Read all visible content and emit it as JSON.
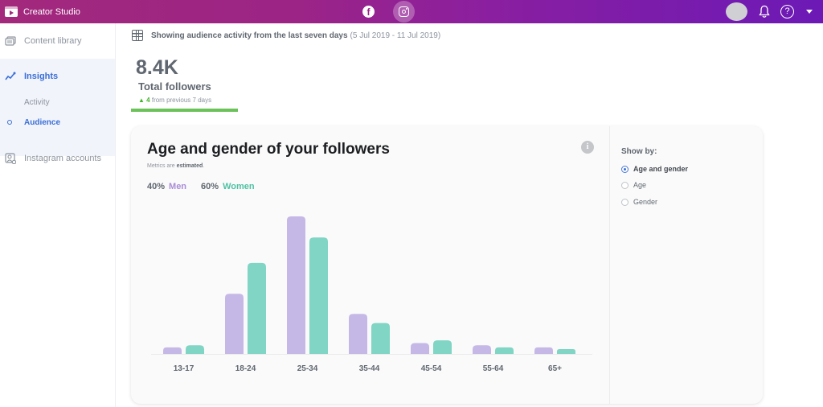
{
  "app": {
    "title": "Creator Studio",
    "platforms": [
      {
        "name": "Facebook",
        "icon": "facebook-icon",
        "active": false
      },
      {
        "name": "Instagram",
        "icon": "instagram-icon",
        "active": true
      }
    ],
    "header_icons": [
      "avatar",
      "bell-icon",
      "help-icon",
      "caret-down-icon"
    ]
  },
  "sidebar": {
    "items": [
      {
        "label": "Content library",
        "icon": "content-library-icon"
      },
      {
        "label": "Insights",
        "icon": "insights-icon",
        "active": true
      },
      {
        "label": "Activity"
      },
      {
        "label": "Audience",
        "active": true
      },
      {
        "label": "Instagram accounts",
        "icon": "instagram-accounts-icon"
      }
    ]
  },
  "header": {
    "date_text": "Showing audience activity from the last seven days",
    "date_range": "(5 Jul 2019 - 11 Jul 2019)"
  },
  "kpi": {
    "value": "8.4K",
    "label": "Total followers",
    "delta_value": "4",
    "delta_text": "from previous 7 days",
    "accent": "#6ac259"
  },
  "card": {
    "title": "Age and gender of your followers",
    "note_prefix": "Metrics are",
    "note_bold": "estimated",
    "note_suffix": ".",
    "men_pct": "40%",
    "men_label": "Men",
    "women_pct": "60%",
    "women_label": "Women",
    "info_icon": "i",
    "show_by_label": "Show by:",
    "show_by_options": [
      {
        "label": "Age and gender",
        "selected": true
      },
      {
        "label": "Age",
        "selected": false
      },
      {
        "label": "Gender",
        "selected": false
      }
    ]
  },
  "chart_data": {
    "type": "bar",
    "title": "Age and gender of your followers",
    "xlabel": "",
    "ylabel": "",
    "categories": [
      "13-17",
      "18-24",
      "25-34",
      "35-44",
      "45-54",
      "55-64",
      "65+"
    ],
    "series": [
      {
        "name": "Men",
        "color": "#c6b8e6",
        "values": [
          1.2,
          11.1,
          25.4,
          7.4,
          2.0,
          1.6,
          1.2
        ]
      },
      {
        "name": "Women",
        "color": "#80d5c4",
        "values": [
          1.6,
          16.8,
          21.5,
          5.7,
          2.5,
          1.2,
          0.9
        ]
      }
    ],
    "ylim": [
      0,
      26
    ],
    "grid": false,
    "legend": "top-left"
  }
}
